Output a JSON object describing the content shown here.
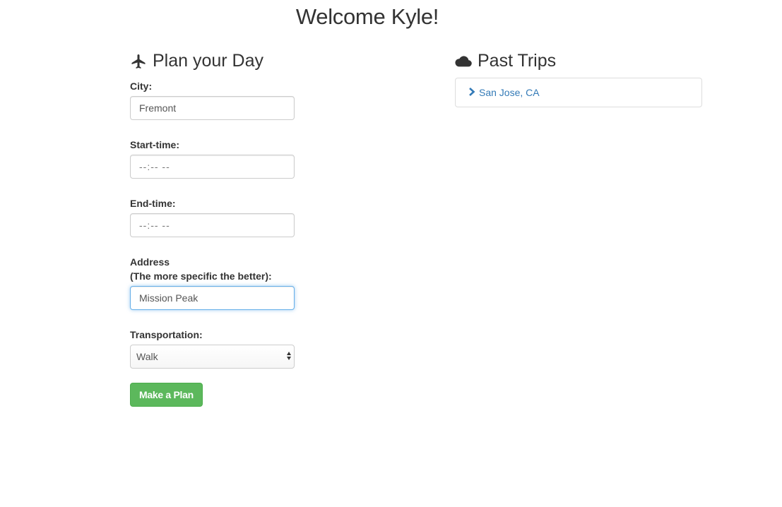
{
  "header": {
    "welcome": "Welcome Kyle!"
  },
  "plan": {
    "title": "Plan your Day",
    "icon": "airplane-icon",
    "fields": {
      "city": {
        "label": "City:",
        "value": "Fremont"
      },
      "start_time": {
        "label": "Start-time:",
        "value": "--:-- --"
      },
      "end_time": {
        "label": "End-time:",
        "value": "--:-- --"
      },
      "address": {
        "label_line1": "Address",
        "label_line2": "(The more specific the better):",
        "value": "Mission Peak"
      },
      "transportation": {
        "label": "Transportation:",
        "selected": "Walk"
      }
    },
    "submit_label": "Make a Plan"
  },
  "past_trips": {
    "title": "Past Trips",
    "icon": "cloud-icon",
    "items": [
      {
        "label": "San Jose, CA",
        "icon": "chevron-right-icon"
      }
    ]
  },
  "colors": {
    "text": "#333333",
    "link": "#337ab7",
    "button": "#5cb85c",
    "focus_border": "#66afe9"
  }
}
